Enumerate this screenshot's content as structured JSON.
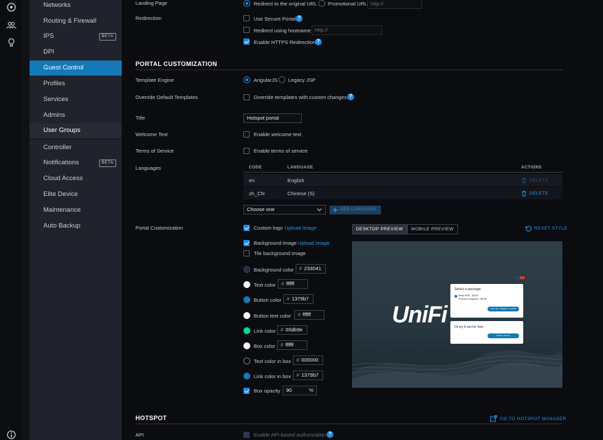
{
  "nav": {
    "items": [
      {
        "label": "Networks"
      },
      {
        "label": "Routing & Firewall"
      },
      {
        "label": "IPS",
        "badge": "BETA"
      },
      {
        "label": "DPI"
      },
      {
        "label": "Guest Control"
      },
      {
        "label": "Profiles"
      },
      {
        "label": "Services"
      },
      {
        "label": "Admins"
      },
      {
        "label": "User Groups"
      },
      {
        "label": "Controller"
      },
      {
        "label": "Notifications",
        "badge": "BETA"
      },
      {
        "label": "Cloud Access"
      },
      {
        "label": "Elite Device"
      },
      {
        "label": "Maintenance"
      },
      {
        "label": "Auto Backup"
      }
    ]
  },
  "landing": {
    "label": "Landing Page",
    "opt1": "Redirect to the original URL",
    "opt2": "Promotional URL",
    "promo_placeholder": "http://"
  },
  "redirection": {
    "label": "Redirection",
    "secure": "Use Secure Portal",
    "hostname": "Redirect using hostname",
    "hostname_value": "http://",
    "https": "Enable HTTPS Redirection"
  },
  "portal": {
    "title": "PORTAL CUSTOMIZATION",
    "template_engine_label": "Template Engine",
    "engine1": "AngularJS",
    "engine2": "Legacy JSP",
    "override_label": "Override Default Templates",
    "override_text": "Override templates with custom changes",
    "title_label": "Title",
    "title_value": "Hotspot portal",
    "welcome_label": "Welcome Text",
    "welcome_text": "Enable welcome text",
    "tos_label": "Terms of Service",
    "tos_text": "Enable terms of service",
    "languages_label": "Languages",
    "languages": {
      "headers": {
        "code": "CODE",
        "language": "LANGUAGE",
        "actions": "ACTIONS"
      },
      "rows": [
        {
          "code": "en",
          "language": "English",
          "action": "DELETE"
        },
        {
          "code": "zh_CN",
          "language": "Chinese (S)",
          "action": "DELETE"
        }
      ],
      "select": "Choose one",
      "add": "ADD LANGUAGE"
    },
    "customization_label": "Portal Customization",
    "custom_logo": "Custom logo",
    "upload_image": "Upload image",
    "bg_image": "Background image",
    "tile_bg": "Tile background image",
    "colors": [
      {
        "label": "Background color",
        "value": "233041",
        "swatch": "#233041"
      },
      {
        "label": "Text color",
        "value": "ffffff",
        "swatch": "#ffffff"
      },
      {
        "label": "Button color",
        "value": "1379b7",
        "swatch": "#1379b7"
      },
      {
        "label": "Button text color",
        "value": "ffffff",
        "swatch": "#ffffff"
      },
      {
        "label": "Link color",
        "value": "00db9e",
        "swatch": "#00db9e"
      },
      {
        "label": "Box color",
        "value": "ffffff",
        "swatch": "#ffffff"
      },
      {
        "label": "Text color in box",
        "value": "000000",
        "swatch": "#000000"
      },
      {
        "label": "Link color in box",
        "value": "1379b7",
        "swatch": "#1379b7"
      }
    ],
    "box_opacity_label": "Box opacity",
    "box_opacity": "90",
    "box_opacity_unit": "%",
    "tabs": {
      "desktop": "DESKTOP PREVIEW",
      "mobile": "MOBILE PREVIEW"
    },
    "reset": "RESET STYLE",
    "preview": {
      "logo": "UniFi",
      "card1_title": "Select a package",
      "card1_opt1": "Basic 8HR - $5.99",
      "card1_opt2": "Premium Daypass - $8.99",
      "card1_button": "PAY BY CREDIT CARD",
      "card2_title": "Or try it out for free",
      "card2_button": "FREE TRIAL"
    }
  },
  "hotspot": {
    "title": "HOTSPOT",
    "manager_link": "GO TO HOTSPOT MANAGER",
    "api_label": "API",
    "api_text": "Enable API-based authorization"
  },
  "colors": {
    "accent": "#1379b7",
    "link": "#1f9be8",
    "bg": "#0a0c10",
    "sidebar": "#20232b"
  }
}
